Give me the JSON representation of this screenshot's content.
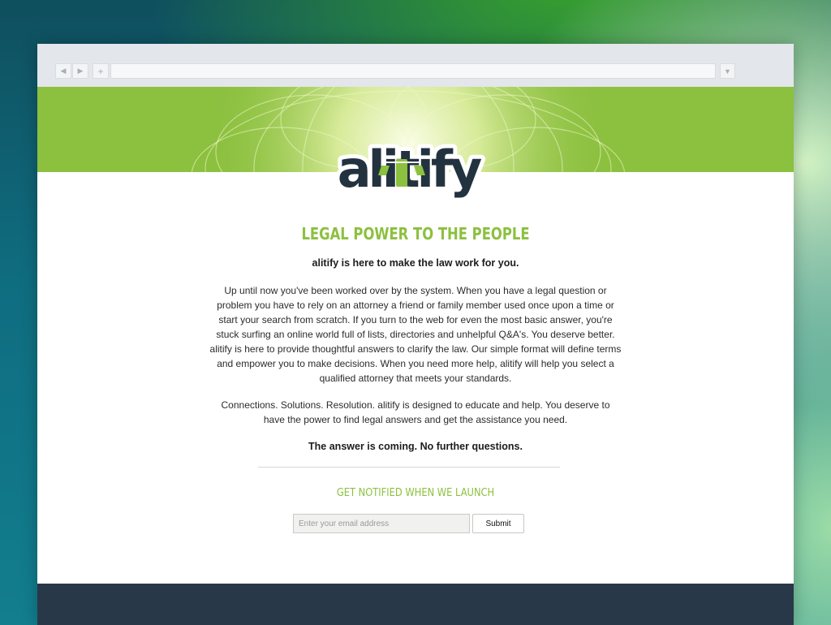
{
  "browser": {
    "back_icon": "back-arrow-icon",
    "forward_icon": "forward-arrow-icon",
    "new_tab_icon": "plus-icon",
    "menu_icon": "chevron-down-icon",
    "back_glyph": "◀",
    "forward_glyph": "▶",
    "plus_glyph": "+",
    "menu_glyph": "▼"
  },
  "brand": {
    "logo_text": "alitify",
    "accent_color": "#8cc03f",
    "dark_color": "#23323f"
  },
  "main": {
    "headline": "LEGAL POWER TO THE PEOPLE",
    "tagline": "alitify is here to make the law work for you.",
    "paragraph1": "Up until now you've been worked over by the system. When you have a legal question or problem you have to rely on an attorney a friend or family member used once upon a time or start your search from scratch. If you turn to the web for even the most basic answer, you're stuck surfing an online world full of lists, directories and unhelpful Q&A's. You deserve better. alitify is here to provide thoughtful answers to clarify the law. Our simple format will define terms and empower you to make decisions. When you need more help, alitify will help you select a qualified attorney that meets your standards.",
    "paragraph2": "Connections. Solutions. Resolution. alitify is designed to educate and help. You deserve to have the power to find legal answers and get the assistance you need.",
    "closing": "The answer is coming. No further questions."
  },
  "signup": {
    "heading": "GET NOTIFIED WHEN WE LAUNCH",
    "email_placeholder": "Enter your email address",
    "submit_label": "Submit"
  }
}
